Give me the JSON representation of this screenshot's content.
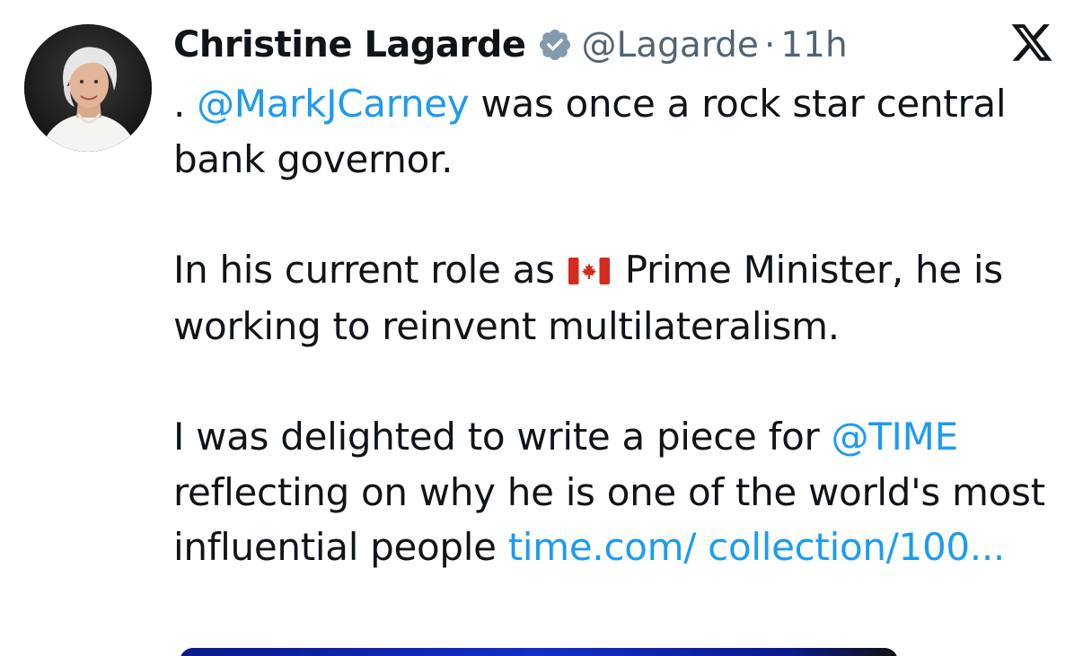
{
  "user": {
    "name": "Christine Lagarde",
    "handle": "@Lagarde",
    "separator": "·",
    "time": "11h",
    "verified_icon": "verified-badge-icon"
  },
  "platform_logo": "x-logo-icon",
  "tweet": {
    "line1_prefix": ". ",
    "mention_carney": "@MarkJCarney",
    "line1_rest": " was once a rock star central bank governor.",
    "para2_prefix": "In his current role as ",
    "flag_icon": "canada-flag-icon",
    "para2_rest": " Prime Minister, he is working to reinvent multilateralism.",
    "para3_prefix": "I was delighted to write a piece for ",
    "mention_time": "@TIME",
    "para3_rest": " reflecting on why he is one of the world's most influential people ",
    "link_text": "time.com/ collection/100..."
  },
  "colors": {
    "link": "#1d9bf0",
    "secondary_text": "#536471",
    "primary_text": "#0f1419"
  }
}
